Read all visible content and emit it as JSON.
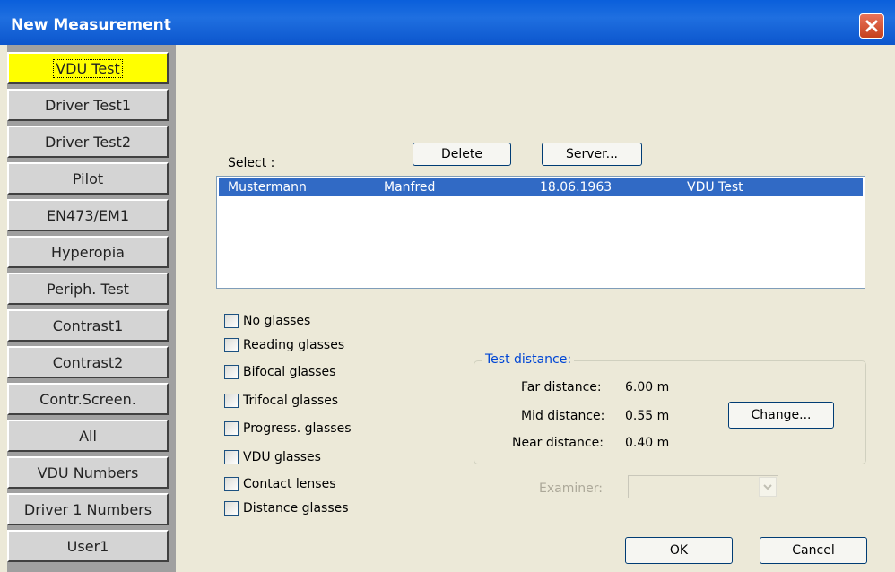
{
  "window": {
    "title": "New Measurement",
    "close_icon": "close-icon"
  },
  "tabs": [
    {
      "label": "VDU Test",
      "active": true
    },
    {
      "label": "Driver Test1"
    },
    {
      "label": "Driver Test2"
    },
    {
      "label": "Pilot"
    },
    {
      "label": "EN473/EM1"
    },
    {
      "label": "Hyperopia"
    },
    {
      "label": "Periph. Test"
    },
    {
      "label": "Contrast1"
    },
    {
      "label": "Contrast2"
    },
    {
      "label": "Contr.Screen."
    },
    {
      "label": "All"
    },
    {
      "label": "VDU Numbers"
    },
    {
      "label": "Driver 1 Numbers"
    },
    {
      "label": "User1"
    }
  ],
  "select": {
    "label": "Select :",
    "delete_label": "Delete",
    "server_label": "Server...",
    "rows": [
      {
        "last": "Mustermann",
        "first": "Manfred",
        "dob": "18.06.1963",
        "test": "VDU Test",
        "selected": true
      }
    ]
  },
  "glasses": [
    {
      "label": "No glasses",
      "checked": false
    },
    {
      "label": "Reading glasses",
      "checked": false
    },
    {
      "label": "Bifocal glasses",
      "checked": false
    },
    {
      "label": "Trifocal glasses",
      "checked": false
    },
    {
      "label": "Progress. glasses",
      "checked": false
    },
    {
      "label": "VDU glasses",
      "checked": false
    },
    {
      "label": "Contact lenses",
      "checked": false
    },
    {
      "label": "Distance glasses",
      "checked": false
    }
  ],
  "test_distance": {
    "title": "Test distance:",
    "far_label": "Far distance:",
    "far_value": "6.00 m",
    "mid_label": "Mid distance:",
    "mid_value": "0.55 m",
    "near_label": "Near distance:",
    "near_value": "0.40 m",
    "change_label": "Change..."
  },
  "examiner": {
    "label": "Examiner:",
    "value": ""
  },
  "footer": {
    "ok_label": "OK",
    "cancel_label": "Cancel"
  },
  "colors": {
    "active_tab": "#ffff00",
    "selection": "#316ac5",
    "titlebar": "#0a5fdb"
  }
}
